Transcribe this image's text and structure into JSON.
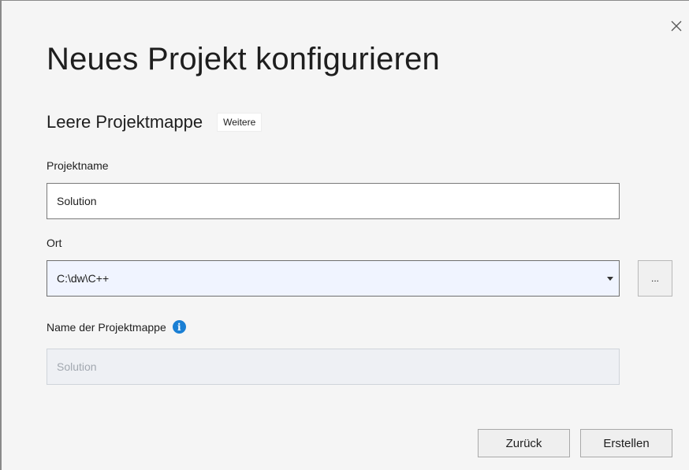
{
  "dialog": {
    "title": "Neues Projekt konfigurieren",
    "close_icon": "close-icon"
  },
  "template": {
    "name": "Leere Projektmappe",
    "more_label": "Weitere"
  },
  "project_name": {
    "label": "Projektname",
    "value": "Solution"
  },
  "location": {
    "label": "Ort",
    "value": "C:\\dw\\C++",
    "browse_label": "..."
  },
  "solution_name": {
    "label": "Name der Projektmappe",
    "info_icon": "info-icon",
    "placeholder": "Solution"
  },
  "footer": {
    "back_label": "Zurück",
    "create_label": "Erstellen"
  },
  "colors": {
    "info_blue": "#1a7fd4",
    "dialog_bg": "#f5f5f5"
  }
}
